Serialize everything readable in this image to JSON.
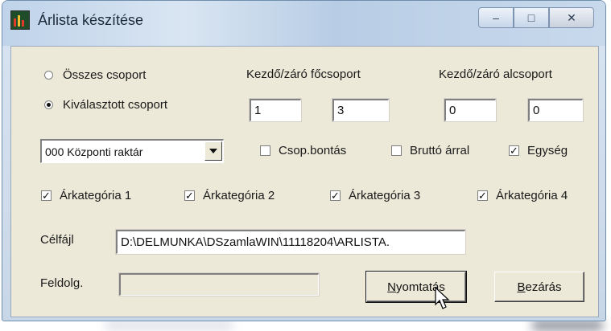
{
  "window": {
    "title": "Árlista készítése",
    "caption_buttons": {
      "minimize": "–",
      "maximize": "□",
      "close": "✕"
    }
  },
  "group_mode": {
    "options": [
      {
        "label": "Összes csoport",
        "selected": false
      },
      {
        "label": "Kiválasztott csoport",
        "selected": true
      }
    ]
  },
  "main_group": {
    "label": "Kezdő/záró főcsoport",
    "start": "1",
    "end": "3"
  },
  "sub_group": {
    "label": "Kezdő/záró alcsoport",
    "start": "0",
    "end": "0"
  },
  "warehouse": {
    "value": "000 Központi raktár"
  },
  "options": {
    "csop_bontas": {
      "label": "Csop.bontás",
      "checked": false
    },
    "brutto_arral": {
      "label": "Bruttó árral",
      "checked": false
    },
    "egyseg": {
      "label": "Egység",
      "checked": true
    }
  },
  "price_categories": [
    {
      "label": "Árkategória 1",
      "checked": true
    },
    {
      "label": "Árkategória 2",
      "checked": true
    },
    {
      "label": "Árkategória 3",
      "checked": true
    },
    {
      "label": "Árkategória 4",
      "checked": true
    }
  ],
  "target_file": {
    "label": "Célfájl",
    "value": "D:\\DELMUNKA\\DSzamlaWIN\\11118204\\ARLISTA."
  },
  "processing": {
    "label": "Feldolg.",
    "progress": 0
  },
  "buttons": {
    "print": {
      "prefix": "",
      "mnemonic": "N",
      "rest": "yomtatás"
    },
    "close": {
      "prefix": "",
      "mnemonic": "B",
      "rest": "ezárás"
    }
  },
  "colors": {
    "dialog_bg": "#ece9d8",
    "titlebar": "#c8d9ec"
  }
}
